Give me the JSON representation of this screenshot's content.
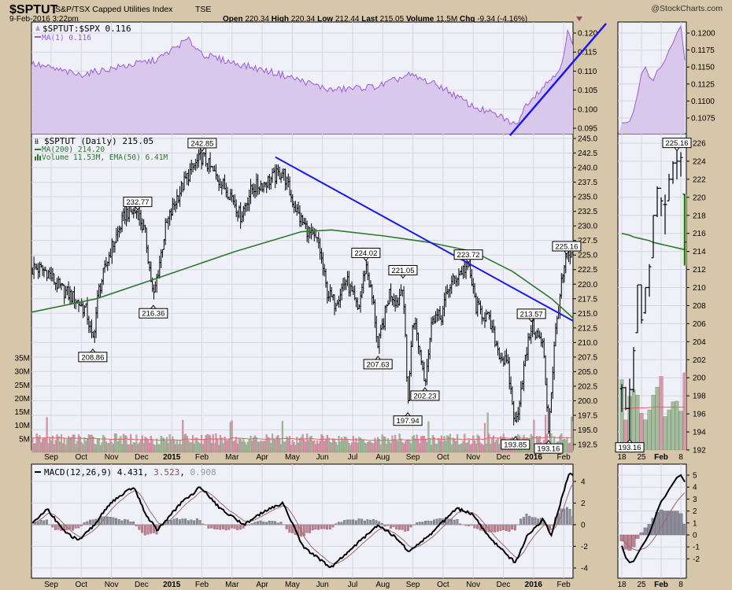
{
  "header": {
    "symbol": "$SPTUT",
    "name": "S&P/TSX Capped Utilities Index",
    "exchange": "TSE",
    "datetime": "9-Feb-2016 3:22pm",
    "brand": "@StockCharts.com",
    "open_label": "Open",
    "open": "220.34",
    "high_label": "High",
    "high": "220.34",
    "low_label": "Low",
    "low": "212.44",
    "last_label": "Last",
    "last": "215.05",
    "volume_label": "Volume",
    "volume": "11.5M",
    "chg_label": "Chg",
    "chg": "-9.34 (-4.16%)",
    "chg_icon": "down-triangle"
  },
  "legends": {
    "ratio": "$SPTUT:$SPX 0.116",
    "ratio_ma": "MA(1) 0.116",
    "price": "$SPTUT (Daily) 215.05",
    "ma200": "MA(200) 214.20",
    "volume": "Volume 11.53M, EMA(50) 6.41M",
    "macd": "MACD(12,26,9) 4.431",
    "macd_signal": "3.523",
    "macd_hist": "0.908",
    "macd_sep1": ",",
    "macd_sep2": ","
  },
  "colors": {
    "background": "#d7c7aa",
    "panel": "#eff0f8",
    "grid": "#d5d6e2",
    "ratio_fill": "#d9c8ec",
    "ratio_line": "#9b59e0",
    "ma200": "#2a7a2a",
    "trendline": "#1a1aee",
    "vol_up": "#a5bc9f",
    "vol_down": "#d79aab",
    "vol_ema": "#e86060",
    "macd_line": "#000000",
    "signal_line": "#9a6a6a",
    "hist": "#8a8a98"
  },
  "chart_data": {
    "type": "ohlc",
    "x_unit": "months since Sep 2014",
    "date_labels": [
      "Sep",
      "Oct",
      "Nov",
      "Dec",
      "2015",
      "Feb",
      "Mar",
      "Apr",
      "May",
      "Jun",
      "Jul",
      "Aug",
      "Sep",
      "Oct",
      "Nov",
      "Dec",
      "2016",
      "Feb"
    ],
    "price_ticks": [
      "192.5",
      "195.0",
      "197.5",
      "200.0",
      "202.5",
      "205.0",
      "207.5",
      "210.0",
      "212.5",
      "215.0",
      "217.5",
      "220.0",
      "222.5",
      "225.0",
      "227.5",
      "230.0",
      "232.5",
      "235.0",
      "237.5",
      "240.0",
      "242.5",
      "245.0"
    ],
    "volume_ticks": [
      "5M",
      "10M",
      "15M",
      "20M",
      "25M",
      "30M",
      "35M"
    ],
    "ratio_ticks": [
      "0.095",
      "0.100",
      "0.105",
      "0.110",
      "0.115",
      "0.120"
    ],
    "macd_ticks": [
      "-4",
      "-2",
      "0",
      "2",
      "4"
    ],
    "price_close_path": [
      [
        -0.62,
        222.5
      ],
      [
        -0.6,
        222.9
      ],
      [
        -0.13,
        222.2
      ],
      [
        0.26,
        219.5
      ],
      [
        0.78,
        217.5
      ],
      [
        1.17,
        215.4
      ],
      [
        1.38,
        210.0
      ],
      [
        1.57,
        218.8
      ],
      [
        1.96,
        225.6
      ],
      [
        2.48,
        232.3
      ],
      [
        2.87,
        232.5
      ],
      [
        3.13,
        228.3
      ],
      [
        3.39,
        217.5
      ],
      [
        3.79,
        229.6
      ],
      [
        4.18,
        235.0
      ],
      [
        4.57,
        239.0
      ],
      [
        5.01,
        242.0
      ],
      [
        5.48,
        238.4
      ],
      [
        6.01,
        235.0
      ],
      [
        6.27,
        231.6
      ],
      [
        6.66,
        236.4
      ],
      [
        7.18,
        237.7
      ],
      [
        7.7,
        239.3
      ],
      [
        7.96,
        235.0
      ],
      [
        8.22,
        231.6
      ],
      [
        8.62,
        228.3
      ],
      [
        8.88,
        226.9
      ],
      [
        9.14,
        218.8
      ],
      [
        9.4,
        216.8
      ],
      [
        9.79,
        220.8
      ],
      [
        10.18,
        215.4
      ],
      [
        10.44,
        223.5
      ],
      [
        10.7,
        216.1
      ],
      [
        10.84,
        209.0
      ],
      [
        11.23,
        218.8
      ],
      [
        11.49,
        216.8
      ],
      [
        11.67,
        220.5
      ],
      [
        11.83,
        199.5
      ],
      [
        12.01,
        214.8
      ],
      [
        12.4,
        203.5
      ],
      [
        12.66,
        214.8
      ],
      [
        12.92,
        214.1
      ],
      [
        13.19,
        219.5
      ],
      [
        13.58,
        222.2
      ],
      [
        13.84,
        223.2
      ],
      [
        14.1,
        216.1
      ],
      [
        14.49,
        214.1
      ],
      [
        14.88,
        208.0
      ],
      [
        15.14,
        206.0
      ],
      [
        15.4,
        195.5
      ],
      [
        15.67,
        205.3
      ],
      [
        15.93,
        213.0
      ],
      [
        16.32,
        209.4
      ],
      [
        16.5,
        195.0
      ],
      [
        16.71,
        210.7
      ],
      [
        16.89,
        218.8
      ],
      [
        17.1,
        224.8
      ],
      [
        17.28,
        224.4
      ],
      [
        17.31,
        215.05
      ]
    ],
    "ma200_path": [
      [
        -0.65,
        215.2
      ],
      [
        1.5,
        217.5
      ],
      [
        3.5,
        221.0
      ],
      [
        6.1,
        225.6
      ],
      [
        8.3,
        229.0
      ],
      [
        9.3,
        229.3
      ],
      [
        11.0,
        228.3
      ],
      [
        12.5,
        227.2
      ],
      [
        14.0,
        225.6
      ],
      [
        15.3,
        222.2
      ],
      [
        16.6,
        217.5
      ],
      [
        17.31,
        214.2
      ]
    ],
    "ratio_path": [
      [
        -0.65,
        0.112
      ],
      [
        0.91,
        0.109
      ],
      [
        2.22,
        0.111
      ],
      [
        3.52,
        0.113
      ],
      [
        4.52,
        0.1183
      ],
      [
        5.09,
        0.1142
      ],
      [
        6.14,
        0.112
      ],
      [
        7.7,
        0.109
      ],
      [
        9.27,
        0.105
      ],
      [
        10.84,
        0.106
      ],
      [
        11.88,
        0.109
      ],
      [
        12.92,
        0.106
      ],
      [
        13.97,
        0.1008
      ],
      [
        15.01,
        0.0977
      ],
      [
        15.4,
        0.0957
      ],
      [
        15.8,
        0.1018
      ],
      [
        16.58,
        0.108
      ],
      [
        16.97,
        0.112
      ],
      [
        17.15,
        0.121
      ],
      [
        17.31,
        0.116
      ]
    ],
    "macd_path": [
      [
        -0.65,
        0
      ],
      [
        -0.13,
        1.5
      ],
      [
        0.39,
        -0.5
      ],
      [
        0.91,
        -1.5
      ],
      [
        1.44,
        0
      ],
      [
        1.96,
        2
      ],
      [
        2.74,
        3.5
      ],
      [
        3.13,
        1
      ],
      [
        3.52,
        -0.5
      ],
      [
        4.31,
        2
      ],
      [
        4.96,
        3.5
      ],
      [
        5.61,
        1.5
      ],
      [
        6.4,
        0
      ],
      [
        6.92,
        1
      ],
      [
        7.7,
        2
      ],
      [
        8.35,
        -2
      ],
      [
        9.27,
        -4
      ],
      [
        10.05,
        -2
      ],
      [
        10.84,
        0
      ],
      [
        11.36,
        -1
      ],
      [
        11.88,
        -2.5
      ],
      [
        12.53,
        -1
      ],
      [
        13.45,
        1.5
      ],
      [
        13.97,
        1
      ],
      [
        14.49,
        -1
      ],
      [
        15.01,
        -2.5
      ],
      [
        15.4,
        -3.5
      ],
      [
        15.8,
        -1
      ],
      [
        16.32,
        0.5
      ],
      [
        16.58,
        -1
      ],
      [
        16.89,
        2
      ],
      [
        17.2,
        4.9
      ],
      [
        17.31,
        4.431
      ]
    ],
    "volume_last_m": 11.53,
    "volume_ema50_m": 6.41,
    "annotations": [
      {
        "m": 5.01,
        "v": 242.85,
        "t": "242.85",
        "pos": "above"
      },
      {
        "m": 2.87,
        "v": 232.77,
        "t": "232.77",
        "pos": "above"
      },
      {
        "m": 1.38,
        "v": 208.86,
        "t": "208.86",
        "pos": "below"
      },
      {
        "m": 3.39,
        "v": 216.36,
        "t": "216.36",
        "pos": "below"
      },
      {
        "m": 10.44,
        "v": 224.02,
        "t": "224.02",
        "pos": "above"
      },
      {
        "m": 10.84,
        "v": 207.63,
        "t": "207.63",
        "pos": "below"
      },
      {
        "m": 11.67,
        "v": 221.05,
        "t": "221.05",
        "pos": "above"
      },
      {
        "m": 11.83,
        "v": 197.94,
        "t": "197.94",
        "pos": "below"
      },
      {
        "m": 12.4,
        "v": 202.23,
        "t": "202.23",
        "pos": "below"
      },
      {
        "m": 13.84,
        "v": 223.72,
        "t": "223.72",
        "pos": "above"
      },
      {
        "m": 15.93,
        "v": 213.57,
        "t": "213.57",
        "pos": "above"
      },
      {
        "m": 15.4,
        "v": 193.85,
        "t": "193.85",
        "pos": "below"
      },
      {
        "m": 16.5,
        "v": 193.16,
        "t": "193.16",
        "pos": "below"
      },
      {
        "m": 17.1,
        "v": 225.16,
        "t": "225.16",
        "pos": "above"
      }
    ],
    "trendlines": {
      "price": [
        [
          7.44,
          241.8
        ],
        [
          17.31,
          213.7
        ]
      ],
      "ratio": [
        [
          15.22,
          0.0931
        ],
        [
          18.41,
          0.1225
        ]
      ]
    },
    "mini": {
      "date_labels": [
        {
          "i": 0,
          "t": "18"
        },
        {
          "i": 5,
          "t": "25"
        },
        {
          "i": 10,
          "t": "Feb"
        },
        {
          "i": 15,
          "t": "8"
        }
      ],
      "price_ticks": [
        "192",
        "194",
        "196",
        "198",
        "200",
        "202",
        "204",
        "206",
        "208",
        "210",
        "212",
        "214",
        "216",
        "218",
        "220",
        "222",
        "224",
        "226"
      ],
      "ratio_ticks": [
        "0.1075",
        "0.1100",
        "0.1125",
        "0.1150",
        "0.1175",
        "0.1200"
      ],
      "macd_ticks": [
        "-2",
        "-1",
        "0",
        "1",
        "2",
        "3",
        "4",
        "5"
      ],
      "ohlc": [
        [
          198.8,
          199.3,
          196.2,
          198.9
        ],
        [
          198.9,
          199.0,
          196.4,
          196.6
        ],
        [
          196.6,
          199.9,
          193.16,
          198.7
        ],
        [
          198.7,
          203.4,
          198.4,
          203.0
        ],
        [
          205.0,
          210.3,
          205.0,
          210.3
        ],
        [
          210.3,
          210.3,
          206.0,
          206.4
        ],
        [
          207.2,
          210.0,
          207.1,
          210.0
        ],
        [
          210.0,
          212.6,
          209.0,
          212.3
        ],
        [
          213.3,
          218.0,
          213.3,
          218.0
        ],
        [
          218.0,
          221.2,
          217.8,
          221.0
        ],
        [
          221.0,
          220.0,
          217.9,
          219.6
        ],
        [
          219.2,
          220.3,
          215.9,
          219.2
        ],
        [
          219.6,
          222.6,
          219.6,
          222.0
        ],
        [
          222.0,
          224.0,
          221.5,
          223.8
        ],
        [
          223.8,
          225.16,
          222.0,
          224.0
        ],
        [
          224.0,
          225.0,
          222.3,
          224.4
        ],
        [
          220.34,
          220.34,
          212.44,
          215.05
        ]
      ],
      "ma200": [
        216.0,
        215.9,
        215.8,
        215.6,
        215.5,
        215.4,
        215.3,
        215.2,
        215.0,
        214.9,
        214.8,
        214.7,
        214.6,
        214.5,
        214.4,
        214.3,
        214.2
      ],
      "volume_m": [
        10.5,
        4.5,
        8.0,
        9.0,
        8.2,
        5.5,
        4.5,
        6.0,
        8.2,
        9.4,
        11.0,
        5.0,
        6.0,
        7.2,
        7.3,
        5.8,
        11.53
      ],
      "volume_ema_m": [
        6.2,
        6.2,
        6.25,
        6.3,
        6.3,
        6.3,
        6.3,
        6.35,
        6.4,
        6.45,
        6.4,
        6.4,
        6.4,
        6.4,
        6.4,
        6.4,
        6.41
      ],
      "ratio": [
        0.1068,
        0.1068,
        0.107,
        0.1085,
        0.111,
        0.114,
        0.115,
        0.1135,
        0.113,
        0.1145,
        0.115,
        0.116,
        0.1175,
        0.1185,
        0.12,
        0.121,
        0.116
      ],
      "macd": [
        -0.9,
        -1.9,
        -2.3,
        -2.2,
        -1.6,
        -1.0,
        -0.5,
        0.1,
        1.0,
        2.0,
        2.8,
        3.2,
        3.8,
        4.3,
        4.8,
        5.0,
        4.431
      ],
      "signal": [
        -0.4,
        -0.7,
        -1.0,
        -1.2,
        -1.3,
        -1.2,
        -1.1,
        -0.8,
        -0.4,
        0.1,
        0.7,
        1.2,
        1.8,
        2.3,
        2.8,
        3.2,
        3.523
      ]
    }
  }
}
